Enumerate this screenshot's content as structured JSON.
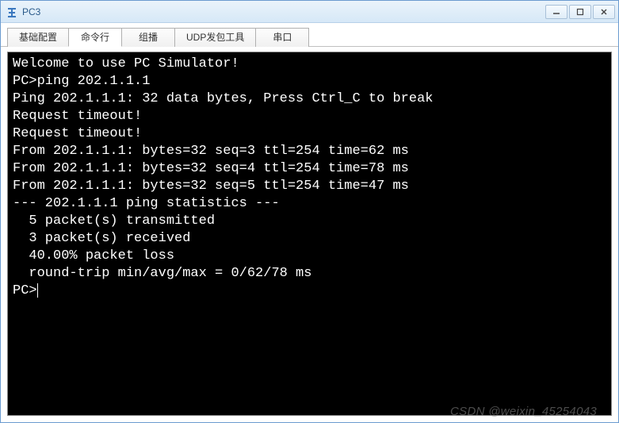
{
  "window": {
    "title": "PC3"
  },
  "tabs": [
    {
      "label": "基础配置",
      "active": false
    },
    {
      "label": "命令行",
      "active": true
    },
    {
      "label": "组播",
      "active": false
    },
    {
      "label": "UDP发包工具",
      "active": false
    },
    {
      "label": "串口",
      "active": false
    }
  ],
  "terminal": {
    "lines": [
      "Welcome to use PC Simulator!",
      "",
      "PC>ping 202.1.1.1",
      "",
      "Ping 202.1.1.1: 32 data bytes, Press Ctrl_C to break",
      "Request timeout!",
      "Request timeout!",
      "From 202.1.1.1: bytes=32 seq=3 ttl=254 time=62 ms",
      "From 202.1.1.1: bytes=32 seq=4 ttl=254 time=78 ms",
      "From 202.1.1.1: bytes=32 seq=5 ttl=254 time=47 ms",
      "",
      "--- 202.1.1.1 ping statistics ---",
      "  5 packet(s) transmitted",
      "  3 packet(s) received",
      "  40.00% packet loss",
      "  round-trip min/avg/max = 0/62/78 ms",
      "",
      "PC>"
    ],
    "prompt": "PC>"
  },
  "watermark": "CSDN @weixin_45254043"
}
